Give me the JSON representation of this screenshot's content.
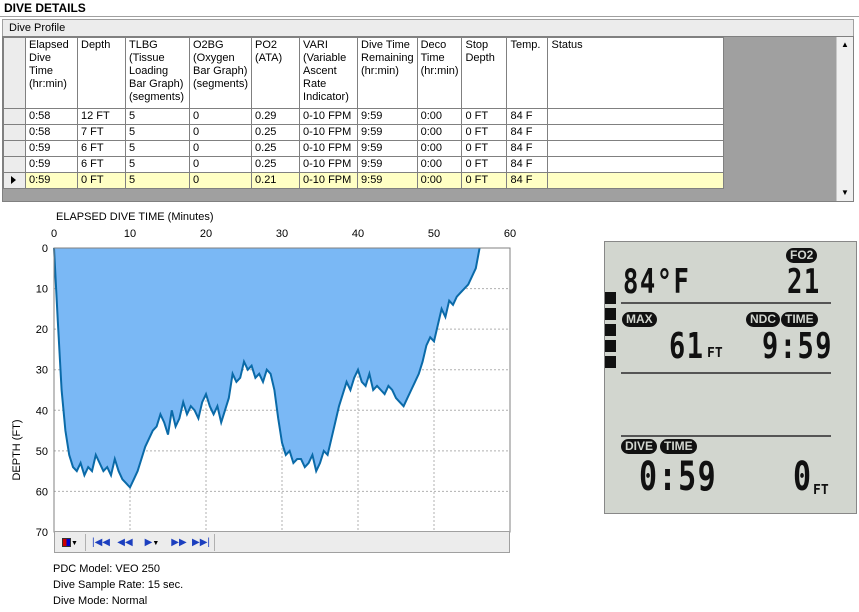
{
  "window": {
    "section_title": "DIVE DETAILS",
    "group_title": "Dive Profile"
  },
  "grid": {
    "columns": [
      "Elapsed Dive Time (hr:min)",
      "Depth",
      "TLBG (Tissue Loading Bar Graph) (segments)",
      "O2BG (Oxygen Bar Graph) (segments)",
      "PO2 (ATA)",
      "VARI (Variable Ascent Rate Indicator)",
      "Dive Time Remaining (hr:min)",
      "Deco Time (hr:min)",
      "Stop Depth",
      "Temp.",
      "Status"
    ],
    "rows": [
      [
        "0:58",
        "12 FT",
        "5",
        "0",
        "0.29",
        "0-10 FPM",
        "9:59",
        "0:00",
        "0 FT",
        "84 F",
        ""
      ],
      [
        "0:58",
        "7 FT",
        "5",
        "0",
        "0.25",
        "0-10 FPM",
        "9:59",
        "0:00",
        "0 FT",
        "84 F",
        ""
      ],
      [
        "0:59",
        "6 FT",
        "5",
        "0",
        "0.25",
        "0-10 FPM",
        "9:59",
        "0:00",
        "0 FT",
        "84 F",
        ""
      ],
      [
        "0:59",
        "6 FT",
        "5",
        "0",
        "0.25",
        "0-10 FPM",
        "9:59",
        "0:00",
        "0 FT",
        "84 F",
        ""
      ],
      [
        "0:59",
        "0 FT",
        "5",
        "0",
        "0.21",
        "0-10 FPM",
        "9:59",
        "0:00",
        "0 FT",
        "84 F",
        ""
      ]
    ],
    "selected_row": 4
  },
  "chart_data": {
    "type": "area",
    "title": "ELAPSED DIVE TIME (Minutes)",
    "xlabel": "ELAPSED DIVE TIME (Minutes)",
    "ylabel": "DEPTH (FT)",
    "xlim": [
      0,
      60
    ],
    "ylim": [
      0,
      70
    ],
    "y_inverted": true,
    "grid": true,
    "x_ticks": [
      "0",
      "10",
      "20",
      "30",
      "40",
      "50",
      "60"
    ],
    "y_ticks": [
      "0",
      "10",
      "20",
      "30",
      "40",
      "50",
      "60",
      "70"
    ],
    "fill_color": "#7ab8f5",
    "line_color": "#0a6aa8",
    "x": [
      0,
      0.5,
      1,
      1.5,
      2,
      2.5,
      3,
      3.5,
      4,
      4.5,
      5,
      5.5,
      6,
      6.5,
      7,
      7.5,
      8,
      8.5,
      9,
      9.5,
      10,
      10.5,
      11,
      11.5,
      12,
      12.5,
      13,
      13.5,
      14,
      14.5,
      15,
      15.5,
      16,
      16.5,
      17,
      17.5,
      18,
      18.5,
      19,
      19.5,
      20,
      20.5,
      21,
      21.5,
      22,
      22.5,
      23,
      23.5,
      24,
      24.5,
      25,
      25.5,
      26,
      26.5,
      27,
      27.5,
      28,
      28.5,
      29,
      29.5,
      30,
      30.5,
      31,
      31.5,
      32,
      32.5,
      33,
      33.5,
      34,
      34.5,
      35,
      35.5,
      36,
      36.5,
      37,
      37.5,
      38,
      38.5,
      39,
      39.5,
      40,
      40.5,
      41,
      41.5,
      42,
      42.5,
      43,
      43.5,
      44,
      44.5,
      45,
      45.5,
      46,
      46.5,
      47,
      47.5,
      48,
      48.5,
      49,
      49.5,
      50,
      50.5,
      51,
      51.5,
      52,
      52.5,
      53,
      53.5,
      54,
      54.5,
      55,
      55.5,
      56,
      56.5,
      57,
      57.5,
      58,
      58.25
    ],
    "values": [
      0,
      18,
      35,
      45,
      51,
      54,
      55,
      53,
      56,
      54,
      55,
      51,
      53,
      55,
      54,
      56,
      52,
      55,
      57,
      58,
      59,
      57,
      55,
      52,
      49,
      47,
      45,
      44,
      41,
      43,
      46,
      40,
      44,
      42,
      38,
      41,
      39,
      40,
      42,
      38,
      36,
      39,
      41,
      39,
      43,
      40,
      37,
      31,
      33,
      32,
      28,
      30,
      29,
      32,
      31,
      33,
      30,
      31,
      35,
      42,
      48,
      51,
      50,
      53,
      52,
      52,
      54,
      53,
      51,
      55,
      53,
      50,
      51,
      47,
      43,
      39,
      36,
      33,
      35,
      32,
      30,
      33,
      34,
      31,
      35,
      34,
      35,
      36,
      34,
      35,
      37,
      38,
      39,
      37,
      35,
      33,
      31,
      28,
      24,
      22,
      23,
      19,
      15,
      17,
      13,
      14,
      12,
      11,
      10,
      9,
      7,
      5,
      0
    ]
  },
  "toolbar": {
    "buttons": [
      "color-picker",
      "first",
      "previous",
      "play",
      "next",
      "last"
    ]
  },
  "info": {
    "pdc_model": "PDC Model: VEO 250",
    "sample_rate": "Dive Sample Rate: 15 sec.",
    "dive_mode": "Dive Mode: Normal"
  },
  "lcd": {
    "temp": "84°F",
    "fo2_label": "FO2",
    "fo2_value": "21",
    "max_label": "MAX",
    "max_depth": "61",
    "max_unit": "FT",
    "ndc_label": "NDC",
    "time_label": "TIME",
    "ndc_time": "9:59",
    "dive_label": "DIVE",
    "dive_time_label": "TIME",
    "dive_time": "0:59",
    "depth": "0",
    "depth_unit": "FT",
    "bar_segments": 5
  }
}
